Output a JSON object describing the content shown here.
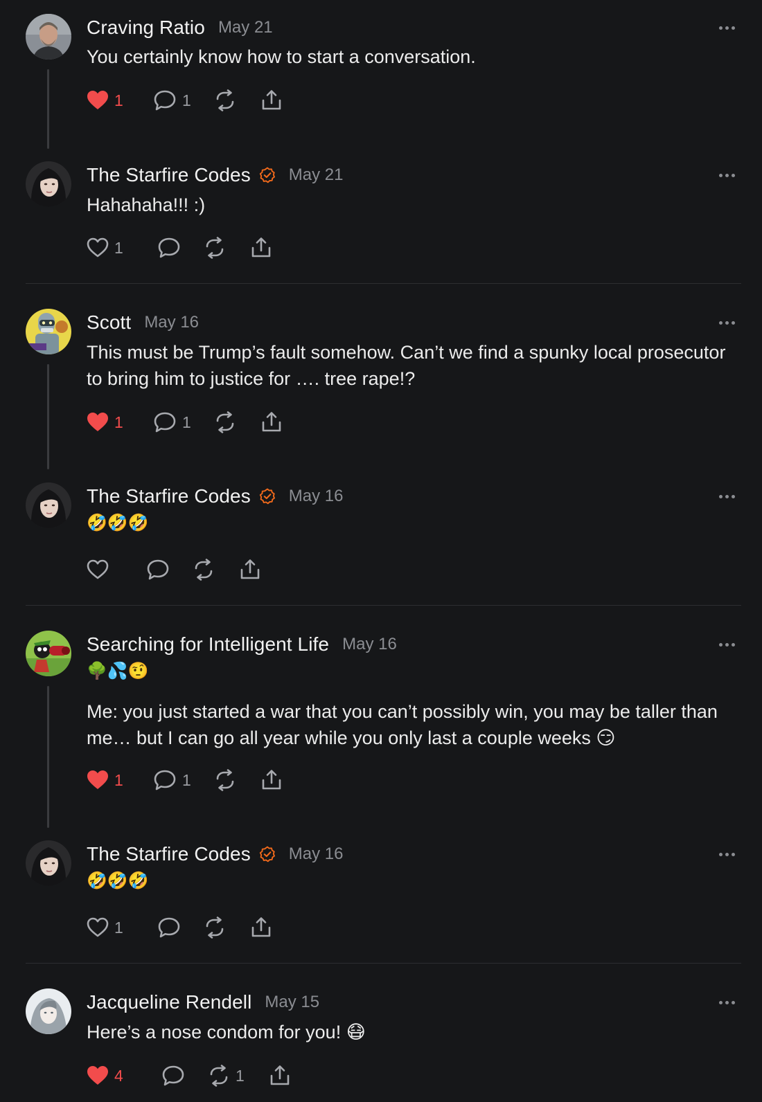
{
  "comments": [
    {
      "author": "Craving Ratio",
      "verified": false,
      "date": "May 21",
      "text": "You certainly know how to start a conversation.",
      "likes": "1",
      "liked": true,
      "replies": "1",
      "restacks": ""
    },
    {
      "author": "The Starfire Codes",
      "verified": true,
      "date": "May 21",
      "text": "Hahahaha!!! :)",
      "likes": "1",
      "liked": false,
      "replies": "",
      "restacks": ""
    },
    {
      "author": "Scott",
      "verified": false,
      "date": "May 16",
      "text": "This must be Trump’s fault somehow. Can’t we find a spunky local prosecutor to bring him to justice for …. tree rape!?",
      "likes": "1",
      "liked": true,
      "replies": "1",
      "restacks": ""
    },
    {
      "author": "The Starfire Codes",
      "verified": true,
      "date": "May 16",
      "text": "🤣🤣🤣",
      "likes": "",
      "liked": false,
      "replies": "",
      "restacks": ""
    },
    {
      "author": "Searching for Intelligent Life",
      "verified": false,
      "date": "May 16",
      "text": "🌳💦🤨",
      "text2": "Me: you just started a war that you can’t possibly win, you may be taller than me… but I can go all year while you only last a couple weeks 😏",
      "likes": "1",
      "liked": true,
      "replies": "1",
      "restacks": ""
    },
    {
      "author": "The Starfire Codes",
      "verified": true,
      "date": "May 16",
      "text": "🤣🤣🤣",
      "likes": "1",
      "liked": false,
      "replies": "",
      "restacks": ""
    },
    {
      "author": "Jacqueline Rendell",
      "verified": false,
      "date": "May 15",
      "text": "Here’s a nose condom for you! 😷",
      "likes": "4",
      "liked": true,
      "replies": "",
      "restacks": "1"
    }
  ],
  "colors": {
    "background": "#161719",
    "like_active": "#f24c4c",
    "verified_badge": "#f26a1b",
    "muted_text": "#8b8d92"
  },
  "icons": [
    "heart-icon",
    "comment-icon",
    "restack-icon",
    "share-icon",
    "verified-icon",
    "more-icon"
  ]
}
